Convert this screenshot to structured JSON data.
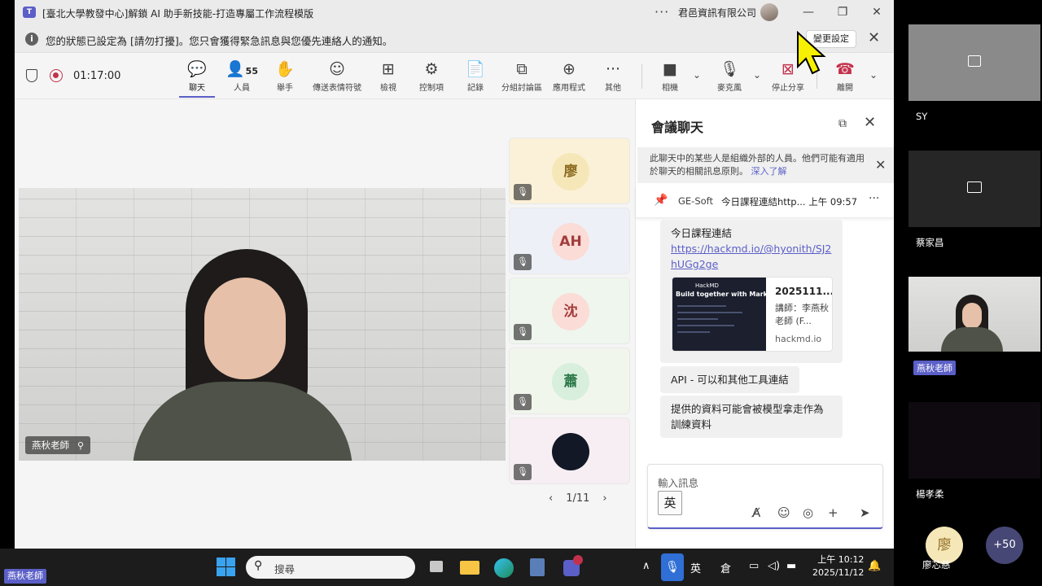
{
  "window": {
    "title": "[臺北大學教發中心]解鎖 AI 助手新技能-打造專屬工作流程模版",
    "more": "···",
    "org": "君邑資訊有限公司",
    "min": "—",
    "restore": "❐",
    "close": "✕"
  },
  "notice": {
    "info": "i",
    "text": "您的狀態已設定為 [請勿打擾]。您只會獲得緊急訊息與您優先連絡人的通知。",
    "change_button": "變更設定",
    "close": "✕"
  },
  "toolbar": {
    "timer": "01:17:00",
    "participant_count": "55",
    "tools": [
      {
        "label": "聊天",
        "icon": "💬"
      },
      {
        "label": "人員",
        "icon": "👤"
      },
      {
        "label": "舉手",
        "icon": "✋"
      },
      {
        "label": "傳送表情符號",
        "icon": "☺"
      },
      {
        "label": "檢視",
        "icon": "⊞"
      },
      {
        "label": "控制項",
        "icon": "⚙"
      },
      {
        "label": "記錄",
        "icon": "📄"
      },
      {
        "label": "分組討論區",
        "icon": "⧉"
      },
      {
        "label": "應用程式",
        "icon": "⊕"
      },
      {
        "label": "其他",
        "icon": "···"
      }
    ],
    "camera": {
      "label": "相機",
      "icon": "■"
    },
    "mic": {
      "label": "麥克風",
      "icon": "🎙"
    },
    "stop_share": {
      "label": "停止分享",
      "icon": "⊠"
    },
    "leave": {
      "label": "離開",
      "icon": "☎"
    },
    "caret": "⌄"
  },
  "stage": {
    "main_name": "燕秋老師",
    "pin": "⚲",
    "tiles": [
      {
        "initial": "廖",
        "bg": "#fbf1d8",
        "fg": "#8a6a1f",
        "avatar_bg": "#f6e7b8"
      },
      {
        "initial": "AH",
        "bg": "#eef0f8",
        "fg": "#a23c3c",
        "avatar_bg": "#fbdcd6"
      },
      {
        "initial": "沈",
        "bg": "#eef6ee",
        "fg": "#a23c3c",
        "avatar_bg": "#fbdcd6"
      },
      {
        "initial": "蕭",
        "bg": "#f1f6ec",
        "fg": "#2f7a4a",
        "avatar_bg": "#d7efdc"
      },
      {
        "initial": "",
        "bg": "#f7eef3",
        "fg": "#ffffff",
        "avatar_bg": "#121826"
      }
    ],
    "mute_icon": "🎙",
    "pager": {
      "prev": "‹",
      "text": "1/11",
      "next": "›"
    }
  },
  "chat": {
    "title": "會議聊天",
    "popout": "⧉",
    "close": "✕",
    "banner_text": "此聊天中的某些人是組織外部的人員。他們可能有適用於聊天的相關訊息原則。",
    "banner_link": "深入了解",
    "banner_close": "✕",
    "pinned": {
      "icon": "📌",
      "sender": "GE-Soft",
      "message": "今日課程連結http... 上午 09:57",
      "more": "···"
    },
    "message1_line": "今日課程連結",
    "message1_link": "https://hackmd.io/@hyonith/SJ2hUGg2ge",
    "card": {
      "brand": "HackMD",
      "headline": "Build together with Markdown",
      "title": "2025111...",
      "desc": "講師：李燕秋老師 (F...",
      "site": "hackmd.io"
    },
    "message2": "API - 可以和其他工具連結",
    "message3": "提供的資料可能會被模型拿走作為訓練資料",
    "compose": {
      "placeholder": "輸入訊息",
      "ime": "英",
      "icons": [
        "A̸",
        "☺",
        "◎",
        "+",
        "➤"
      ]
    }
  },
  "right_panel": {
    "tiles": [
      {
        "name": "SY"
      },
      {
        "name": "蔡家昌"
      },
      {
        "name": "燕秋老師"
      },
      {
        "name": "楊孝柔"
      }
    ],
    "bottom_avatar": {
      "initial": "廖",
      "name": "廖芯慈"
    },
    "overflow": "+50"
  },
  "taskbar": {
    "search_icon": "⚲",
    "search_placeholder": "搜尋",
    "tray_caret": "∧",
    "mic": "🎙",
    "ime1": "英",
    "ime2": "倉",
    "time": "上午 10:12",
    "date": "2025/11/12",
    "presenter_tag": "燕秋老師"
  }
}
